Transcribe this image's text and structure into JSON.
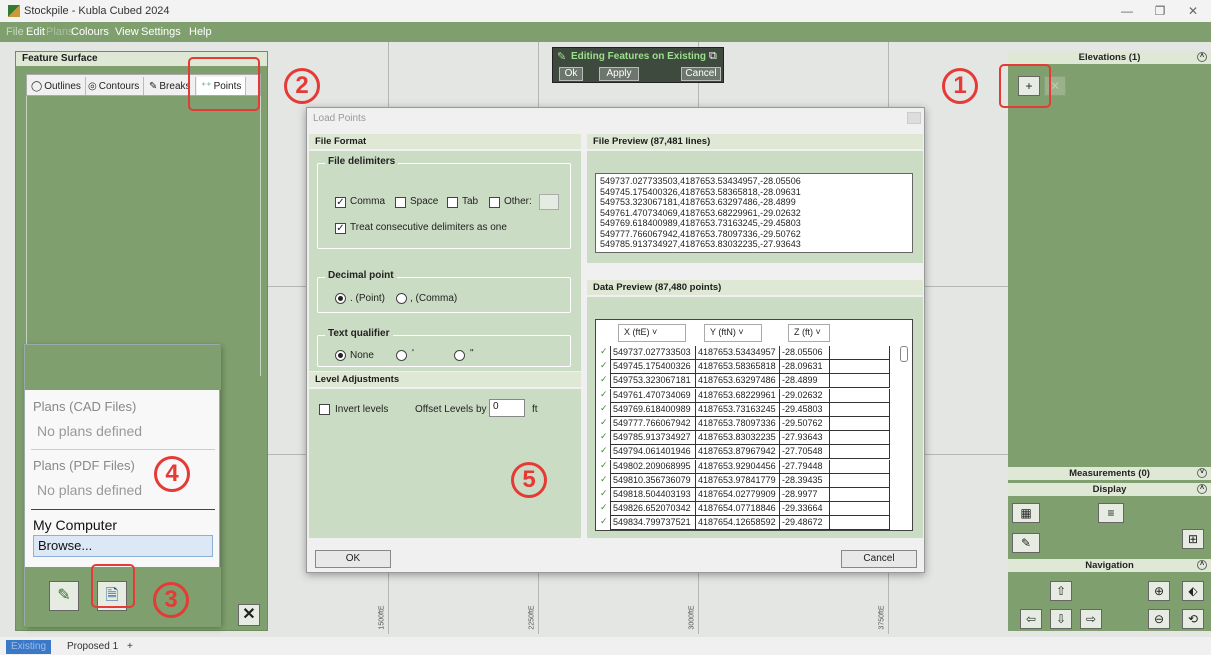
{
  "app": {
    "title": "Stockpile - Kubla Cubed 2024",
    "win_min": "—",
    "win_max": "❐",
    "win_close": "✕"
  },
  "menu": [
    "File",
    "Edit",
    "Plans",
    "Colours",
    "View",
    "Settings",
    "Help"
  ],
  "left_panel": {
    "title": "Feature Surface",
    "tabs": [
      "Outlines",
      "Contours",
      "Breaks",
      "Points"
    ]
  },
  "popup": {
    "plans_cad": "Plans (CAD Files)",
    "plans_cad_none": "No plans defined",
    "plans_pdf": "Plans (PDF Files)",
    "plans_pdf_none": "No plans defined",
    "my_computer": "My Computer",
    "browse": "Browse..."
  },
  "edit_bar": {
    "title": "Editing Features on Existing",
    "ok": "Ok",
    "apply": "Apply",
    "cancel": "Cancel"
  },
  "dialog": {
    "title": "Load Points",
    "file_format": "File Format",
    "file_delimiters": "File delimiters",
    "delims": [
      {
        "label": "Comma",
        "checked": true
      },
      {
        "label": "Space",
        "checked": false
      },
      {
        "label": "Tab",
        "checked": false
      },
      {
        "label": "Other:",
        "checked": false
      }
    ],
    "treat_consecutive": "Treat consecutive delimiters as one",
    "decimal_point": "Decimal point",
    "decimal_options": [
      ". (Point)",
      ", (Comma)"
    ],
    "text_qualifier": "Text qualifier",
    "qualifier_options": [
      "None",
      "'",
      "\""
    ],
    "level_adjustments": "Level Adjustments",
    "invert_levels": "Invert levels",
    "offset_label": "Offset Levels by",
    "offset_value": "0",
    "offset_unit": "ft",
    "file_preview_title": "File Preview  (87,481 lines)",
    "file_lines": [
      "549737.027733503,4187653.53434957,-28.05506",
      "549745.175400326,4187653.58365818,-28.09631",
      "549753.323067181,4187653.63297486,-28.4899",
      "549761.470734069,4187653.68229961,-29.02632",
      "549769.618400989,4187653.73163245,-29.45803",
      "549777.766067942,4187653.78097336,-29.50762",
      "549785.913734927,4187653.83032235,-27.93643"
    ],
    "data_preview_title": "Data Preview  (87,480 points)",
    "columns": [
      "X (ftE)",
      "Y (ftN)",
      "Z (ft)"
    ],
    "rows": [
      [
        "549737.027733503",
        "4187653.53434957",
        "-28.05506"
      ],
      [
        "549745.175400326",
        "4187653.58365818",
        "-28.09631"
      ],
      [
        "549753.323067181",
        "4187653.63297486",
        "-28.4899"
      ],
      [
        "549761.470734069",
        "4187653.68229961",
        "-29.02632"
      ],
      [
        "549769.618400989",
        "4187653.73163245",
        "-29.45803"
      ],
      [
        "549777.766067942",
        "4187653.78097336",
        "-29.50762"
      ],
      [
        "549785.913734927",
        "4187653.83032235",
        "-27.93643"
      ],
      [
        "549794.061401946",
        "4187653.87967942",
        "-27.70548"
      ],
      [
        "549802.209068995",
        "4187653.92904456",
        "-27.79448"
      ],
      [
        "549810.356736079",
        "4187653.97841779",
        "-28.39435"
      ],
      [
        "549818.504403193",
        "4187654.02779909",
        "-28.9977"
      ],
      [
        "549826.652070342",
        "4187654.07718846",
        "-29.33664"
      ],
      [
        "549834.799737521",
        "4187654.12658592",
        "-29.48672"
      ]
    ],
    "ok": "OK",
    "cancel": "Cancel"
  },
  "right_panel": {
    "elevations": "Elevations (1)",
    "measurements": "Measurements (0)",
    "display": "Display",
    "navigation": "Navigation"
  },
  "callouts": [
    "1",
    "2",
    "3",
    "4",
    "5"
  ],
  "bottom_tabs": [
    "Existing",
    "Proposed 1",
    "+"
  ],
  "axis_labels": [
    "1500ftE",
    "2250ftE",
    "3000ftE",
    "3750ftE"
  ]
}
